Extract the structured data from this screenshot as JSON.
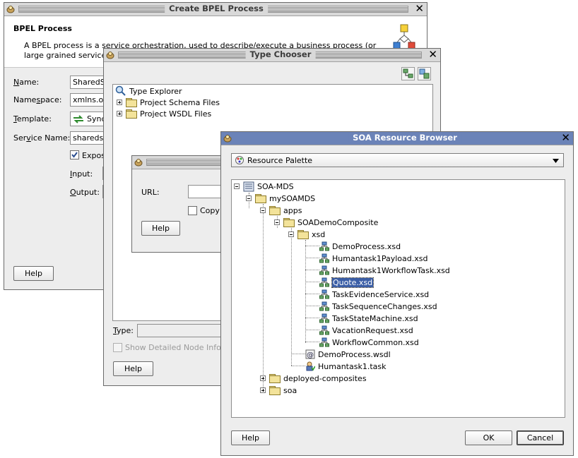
{
  "bpel": {
    "title": "Create BPEL Process",
    "heading": "BPEL Process",
    "desc1": "A BPEL process is a service orchestration, used to describe/execute a business process (or",
    "desc2": "large grained service",
    "name_label": "Name:",
    "name_value": "SharedS",
    "namespace_label": "Namespace:",
    "namespace_value": "xmlns.or",
    "template_label": "Template:",
    "template_value": "Sync",
    "service_label": "Service Name:",
    "service_value": "shareds",
    "expose_label": "Expos",
    "input_label": "Input:",
    "output_label": "Output:",
    "help": "Help"
  },
  "type_chooser": {
    "title": "Type Chooser",
    "tree_root": "Type Explorer",
    "schema_files": "Project Schema Files",
    "wsdl_files": "Project WSDL Files",
    "type_label": "Type:",
    "show_detail": "Show Detailed Node Infor",
    "help": "Help"
  },
  "import_dialog": {
    "url_label": "URL:",
    "copy_label": "Copy",
    "help": "Help"
  },
  "soa": {
    "title": "SOA Resource Browser",
    "palette": "Resource Palette",
    "tree": {
      "root": "SOA-MDS",
      "mysoamds": "mySOAMDS",
      "apps": "apps",
      "composite": "SOADemoComposite",
      "xsd": "xsd",
      "xsd_files": [
        "DemoProcess.xsd",
        "Humantask1Payload.xsd",
        "Humantask1WorkflowTask.xsd",
        "Quote.xsd",
        "TaskEvidenceService.xsd",
        "TaskSequenceChanges.xsd",
        "TaskStateMachine.xsd",
        "VacationRequest.xsd",
        "WorkflowCommon.xsd"
      ],
      "wsdl": "DemoProcess.wsdl",
      "task": "Humantask1.task",
      "deployed": "deployed-composites",
      "soa": "soa"
    },
    "help": "Help",
    "ok": "OK",
    "cancel": "Cancel",
    "selected_color": "#3b5ea6"
  }
}
